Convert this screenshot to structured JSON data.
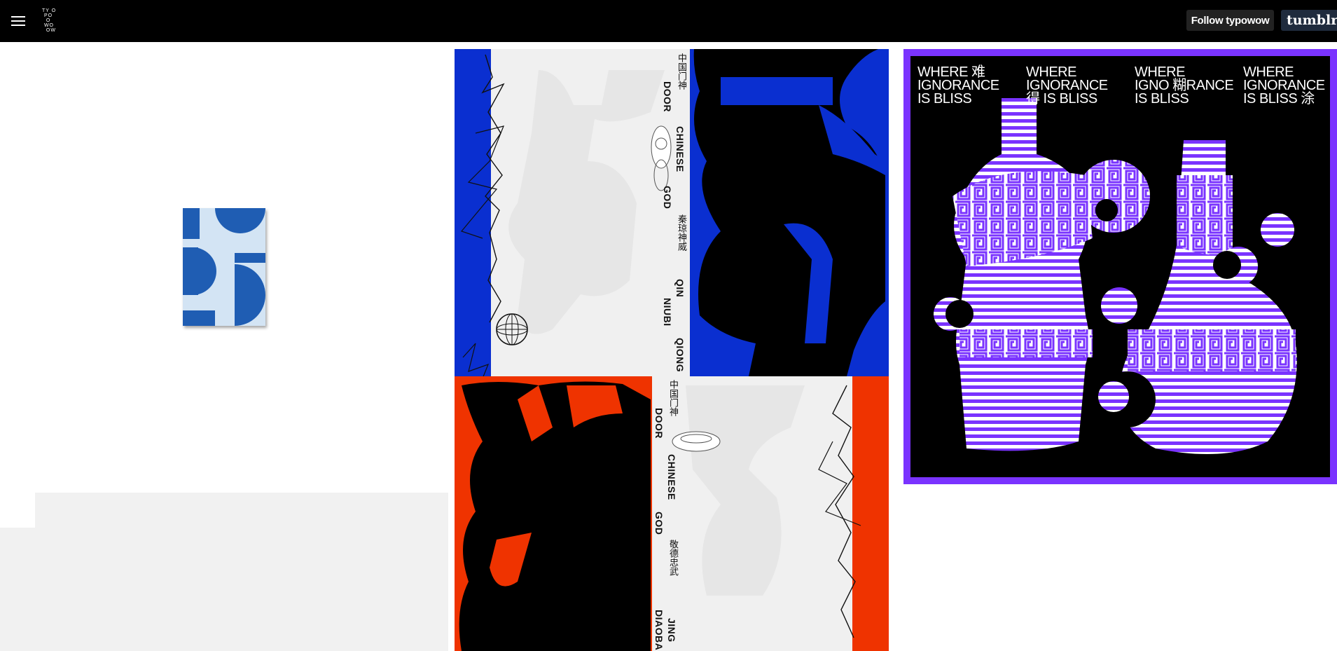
{
  "header": {
    "menu_icon": "hamburger-menu-icon",
    "logo_lines": [
      "TY O",
      " PO",
      "  O",
      " WO",
      "  OW"
    ],
    "follow_label": "Follow typowow",
    "tumblr_label": "tumblr"
  },
  "colors": {
    "header_bg": "#000000",
    "blue": "#0a2fd0",
    "red": "#ef3300",
    "purple": "#7a33ff",
    "thumb_blue": "#1f5db3"
  },
  "posts": {
    "door_gods": {
      "top_panel": {
        "cjk_title": "中国门神",
        "line_door": "DOOR",
        "line_chinese": "CHINESE",
        "line_god": "GOD",
        "cjk_name": "秦琼神威",
        "line_qin": "QIN",
        "line_niubi": "NIUBI",
        "line_qiong": "QIONG"
      },
      "bottom_panel": {
        "cjk_title": "中国门神",
        "line_door": "DOOR",
        "line_chinese": "CHINESE",
        "line_god": "GOD",
        "cjk_name": "敬德忠武",
        "line_jing": "JING",
        "line_diaoba": "DIAOBA"
      }
    },
    "ignorance": {
      "columns": [
        {
          "l1": "WHERE 难",
          "l2": "IGNORANCE",
          "l3": "IS BLISS"
        },
        {
          "l1": "WHERE",
          "l2": "IGNORANCE",
          "l3": "得 IS BLISS"
        },
        {
          "l1": "WHERE",
          "l2": "IGNO 糊RANCE",
          "l3": "IS BLISS"
        },
        {
          "l1": "WHERE",
          "l2": "IGNORANCE",
          "l3": "IS BLISS 涂"
        }
      ]
    }
  }
}
